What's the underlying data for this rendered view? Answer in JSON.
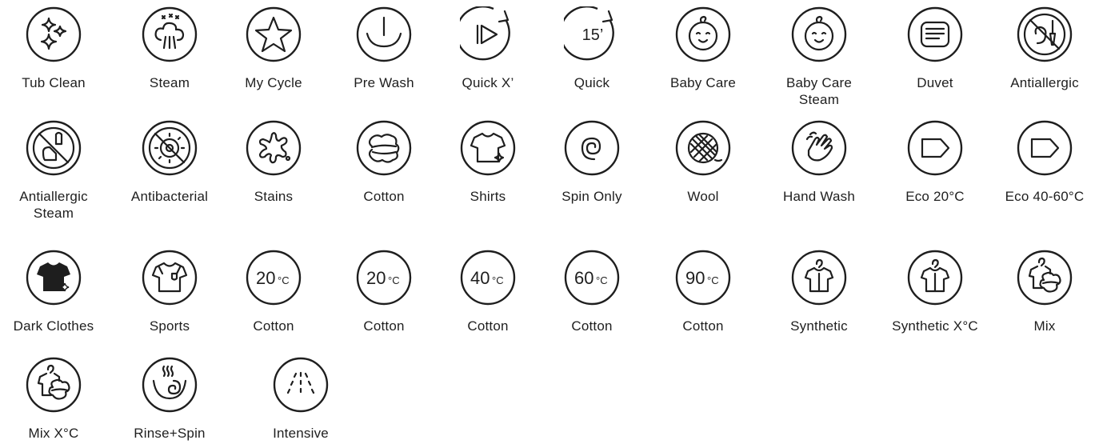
{
  "rows": [
    [
      {
        "label": "Tub Clean",
        "icon": "tub-clean-icon"
      },
      {
        "label": "Steam",
        "icon": "steam-icon"
      },
      {
        "label": "My Cycle",
        "icon": "my-cycle-icon"
      },
      {
        "label": "Pre Wash",
        "icon": "pre-wash-icon"
      },
      {
        "label": "Quick X’",
        "icon": "quick-x-icon"
      },
      {
        "label": "Quick",
        "icon": "quick-15-icon",
        "text": "15’"
      },
      {
        "label": "Baby Care",
        "icon": "baby-care-icon"
      },
      {
        "label": "Baby Care Steam",
        "icon": "baby-care-steam-icon"
      },
      {
        "label": "Duvet",
        "icon": "duvet-icon"
      },
      {
        "label": "Antiallergic",
        "icon": "antiallergic-icon"
      }
    ],
    [
      {
        "label": "Antiallergic Steam",
        "icon": "antiallergic-steam-icon"
      },
      {
        "label": "Antibacterial",
        "icon": "antibacterial-icon"
      },
      {
        "label": "Stains",
        "icon": "stains-icon"
      },
      {
        "label": "Cotton",
        "icon": "cotton-icon"
      },
      {
        "label": "Shirts",
        "icon": "shirts-icon"
      },
      {
        "label": "Spin Only",
        "icon": "spin-only-icon"
      },
      {
        "label": "Wool",
        "icon": "wool-icon"
      },
      {
        "label": "Hand Wash",
        "icon": "hand-wash-icon"
      },
      {
        "label": "Eco 20°C",
        "icon": "eco-20-icon"
      },
      {
        "label": "Eco 40-60°C",
        "icon": "eco-40-60-icon"
      }
    ],
    [
      {
        "label": "Dark Clothes",
        "icon": "dark-clothes-icon"
      },
      {
        "label": "Sports",
        "icon": "sports-icon"
      },
      {
        "label": "Cotton",
        "icon": "cotton-20-icon",
        "temp": "20",
        "unit": "°C"
      },
      {
        "label": "Cotton",
        "icon": "cotton-20-icon",
        "temp": "20",
        "unit": "°C"
      },
      {
        "label": "Cotton",
        "icon": "cotton-40-icon",
        "temp": "40",
        "unit": "°C"
      },
      {
        "label": "Cotton",
        "icon": "cotton-60-icon",
        "temp": "60",
        "unit": "°C"
      },
      {
        "label": "Cotton",
        "icon": "cotton-90-icon",
        "temp": "90",
        "unit": "°C"
      },
      {
        "label": "Synthetic",
        "icon": "synthetic-icon"
      },
      {
        "label": "Synthetic X°C",
        "icon": "synthetic-x-icon"
      },
      {
        "label": "Mix",
        "icon": "mix-icon"
      }
    ],
    [
      {
        "label": "Mix X°C",
        "icon": "mix-x-icon"
      },
      {
        "label": "Rinse+Spin",
        "icon": "rinse-spin-icon"
      },
      {
        "label": "Intensive",
        "icon": "intensive-icon"
      }
    ]
  ]
}
